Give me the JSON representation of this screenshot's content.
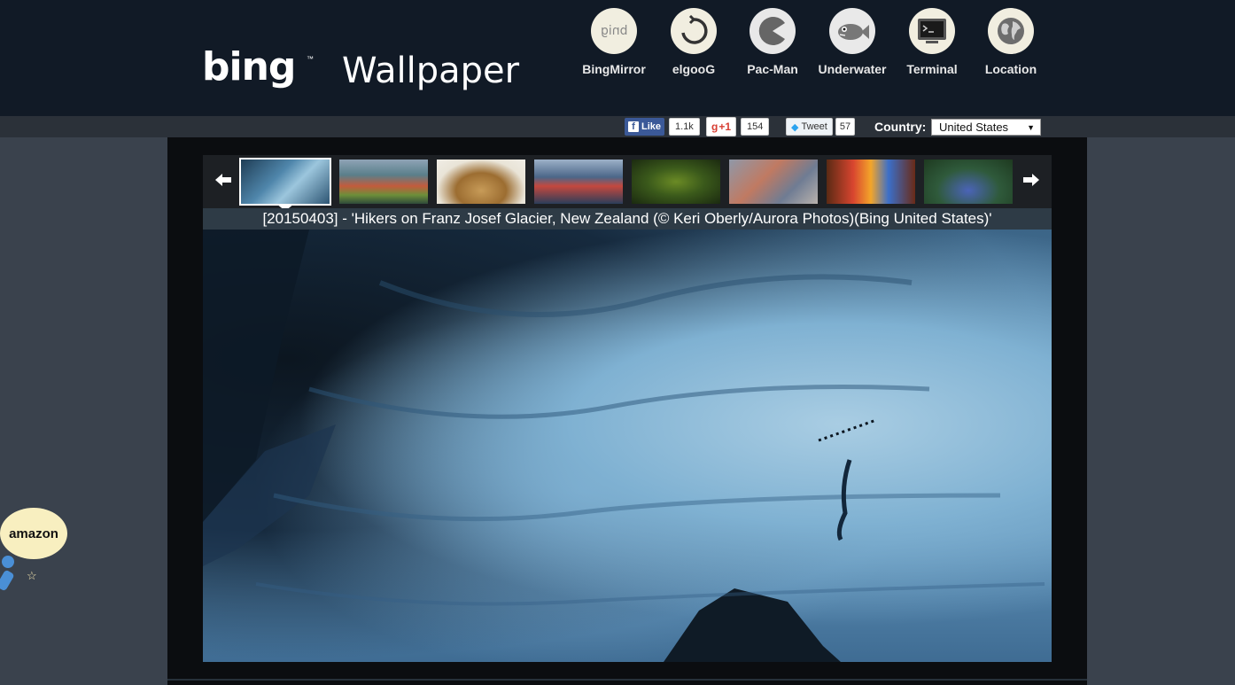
{
  "header": {
    "logo_text": "bing",
    "logo_tm": "™",
    "logo_suffix": "Wallpaper",
    "nav": [
      {
        "label": "BingMirror",
        "icon": "bingmirror-icon"
      },
      {
        "label": "elgooG",
        "icon": "elgoog-icon"
      },
      {
        "label": "Pac-Man",
        "icon": "pacman-icon"
      },
      {
        "label": "Underwater",
        "icon": "fish-icon"
      },
      {
        "label": "Terminal",
        "icon": "terminal-icon"
      },
      {
        "label": "Location",
        "icon": "globe-icon"
      }
    ],
    "bingmirror_glyph": "bnig"
  },
  "social": {
    "fb_like": "Like",
    "fb_count": "1.1k",
    "gplus": "+1",
    "gplus_count": "154",
    "tweet": "Tweet",
    "tweet_count": "57"
  },
  "country": {
    "label": "Country:",
    "selected": "United States"
  },
  "carousel": {
    "prev": "🡐",
    "next": "🡒",
    "selected_index": 0,
    "caption": "[20150403] - 'Hikers on Franz Josef Glacier, New Zealand (© Keri Oberly/Aurora Photos)(Bing United States)'"
  },
  "colors": {
    "header_bg": "#111a26",
    "page_bg": "#3a424d",
    "main_bg": "#0b0d10"
  },
  "amazon": {
    "label": "amazon",
    "star": "☆"
  }
}
